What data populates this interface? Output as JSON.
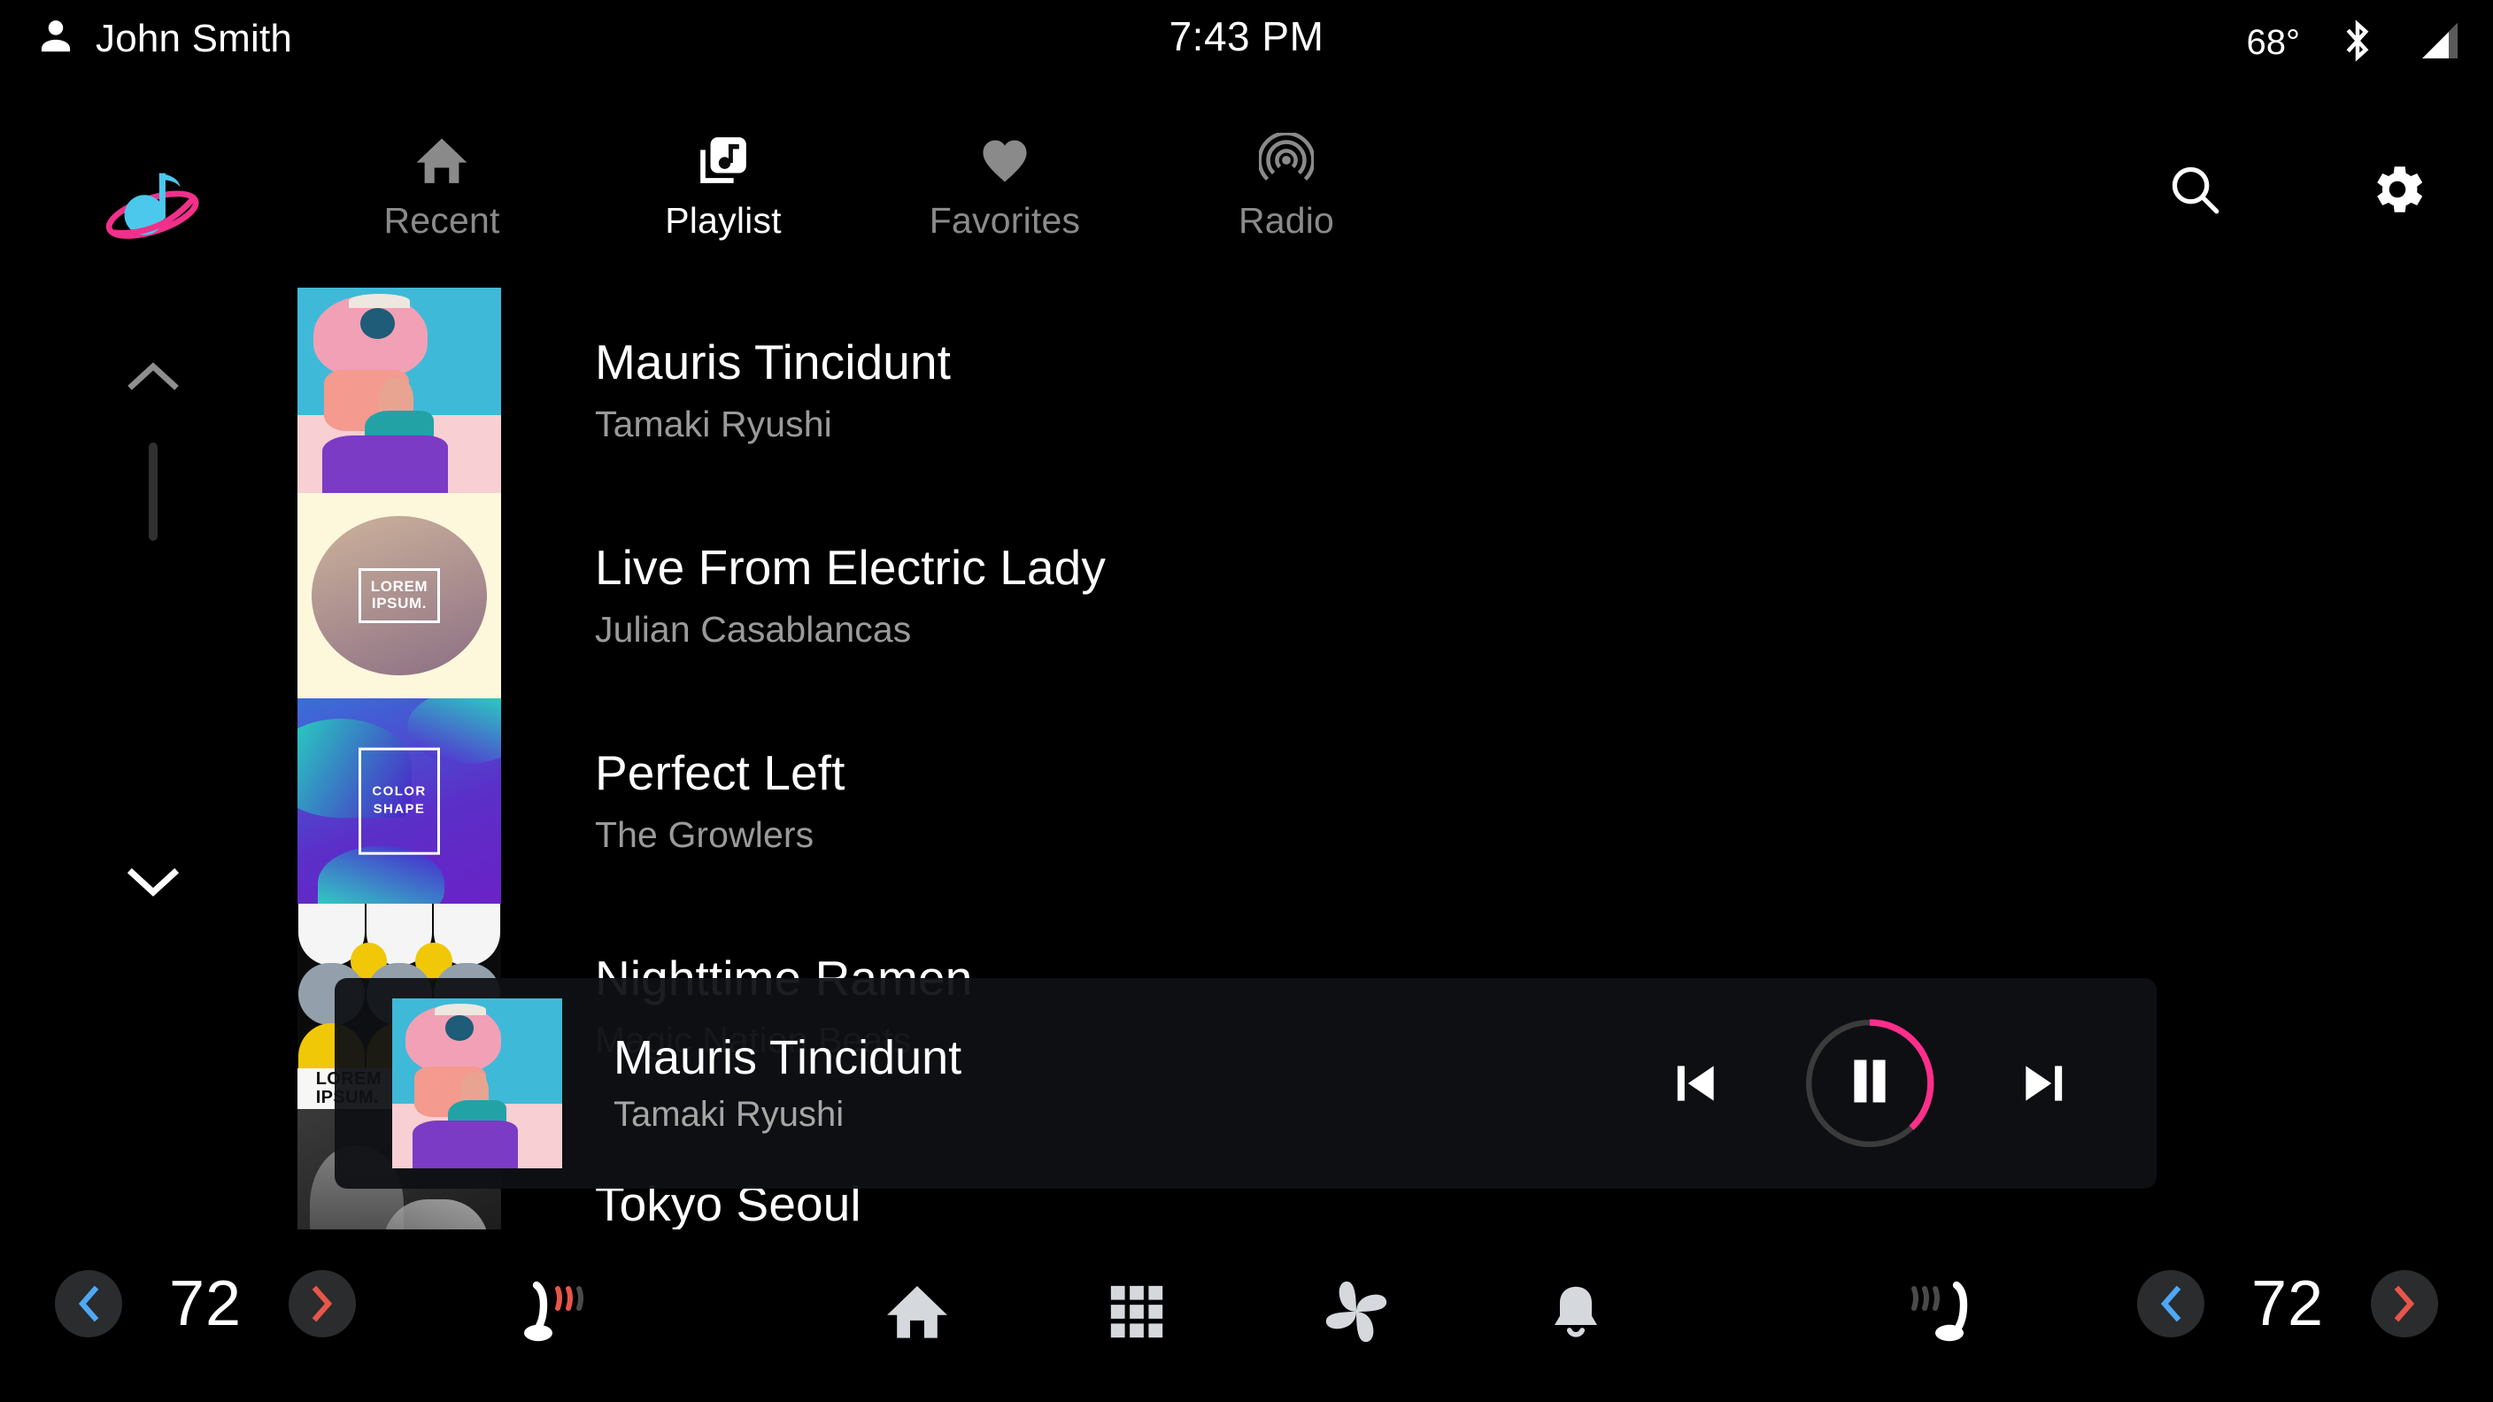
{
  "status_bar": {
    "user_icon": "person-icon",
    "user_name": "John Smith",
    "clock": "7:43 PM",
    "temperature": "68°",
    "bluetooth_icon": "bluetooth-icon",
    "signal_icon": "signal-bars-icon"
  },
  "app": {
    "logo_icon": "music-planet-logo-icon",
    "logo_colors": {
      "note": "#4BC8EC",
      "ring": "#F0308A"
    }
  },
  "tabs": [
    {
      "label": "Recent",
      "icon": "home-icon",
      "active": false
    },
    {
      "label": "Playlist",
      "icon": "library-music-icon",
      "active": true
    },
    {
      "label": "Favorites",
      "icon": "heart-icon",
      "active": false
    },
    {
      "label": "Radio",
      "icon": "broadcast-icon",
      "active": false
    }
  ],
  "header_actions": [
    {
      "name": "search-icon",
      "label": "Search"
    },
    {
      "name": "gear-icon",
      "label": "Settings"
    }
  ],
  "scroll": {
    "up_icon": "chevron-up-icon",
    "down_icon": "chevron-down-icon",
    "thumb_position_pct": 0,
    "thumb_size_pct": 27
  },
  "track_list": [
    {
      "title": "Mauris Tincidunt",
      "artist": "Tamaki Ryushi",
      "art": "art-pinkhair",
      "art_label": ""
    },
    {
      "title": "Live From Electric Lady",
      "artist": "Julian Casablancas",
      "art": "art-lorem",
      "art_label": "LOREM\nIPSUM."
    },
    {
      "title": "Perfect Left",
      "artist": "The Growlers",
      "art": "art-colorshape",
      "art_label": "COLOR\nSHAPE"
    },
    {
      "title": "Nighttime Ramen",
      "artist": "Magic Nation Beats",
      "art": "art-geo",
      "art_label": "LOREM\nIPSUM."
    },
    {
      "title": "Tokyo Seoul",
      "artist": "",
      "art": "art-bw",
      "art_label": ""
    }
  ],
  "now_playing": {
    "title": "Mauris Tincidunt",
    "artist": "Tamaki Ryushi",
    "art": "art-pinkhair",
    "previous_icon": "skip-previous-icon",
    "play_pause_icon": "pause-icon",
    "next_icon": "skip-next-icon",
    "progress_pct": 38,
    "progress_color": "#FF2E8B",
    "track_color": "#3B3B3B"
  },
  "climate": {
    "left": {
      "decrease_icon": "chevron-left-icon",
      "value": "72",
      "increase_icon": "chevron-right-icon",
      "seat_icon": "heated-seat-icon",
      "seat_active": true
    },
    "right": {
      "decrease_icon": "chevron-left-icon",
      "value": "72",
      "increase_icon": "chevron-right-icon",
      "seat_icon": "heated-seat-icon",
      "seat_active": false
    },
    "decrease_color": "#4FA8F5",
    "increase_color": "#E8564A"
  },
  "bottom_nav": [
    {
      "name": "home-icon",
      "label": "Home"
    },
    {
      "name": "apps-grid-icon",
      "label": "Apps"
    },
    {
      "name": "fan-icon",
      "label": "Climate"
    },
    {
      "name": "bell-icon",
      "label": "Notifications"
    }
  ]
}
